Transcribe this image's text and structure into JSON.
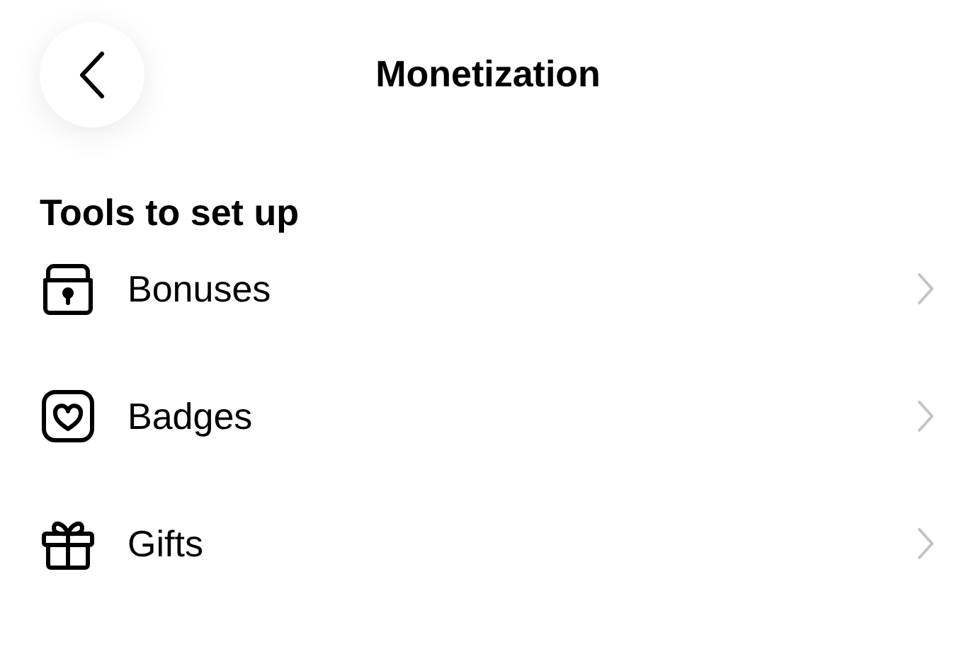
{
  "header": {
    "title": "Monetization"
  },
  "section": {
    "title": "Tools to set up"
  },
  "items": [
    {
      "label": "Bonuses",
      "kind": "bonuses"
    },
    {
      "label": "Badges",
      "kind": "badges"
    },
    {
      "label": "Gifts",
      "kind": "gifts"
    }
  ]
}
